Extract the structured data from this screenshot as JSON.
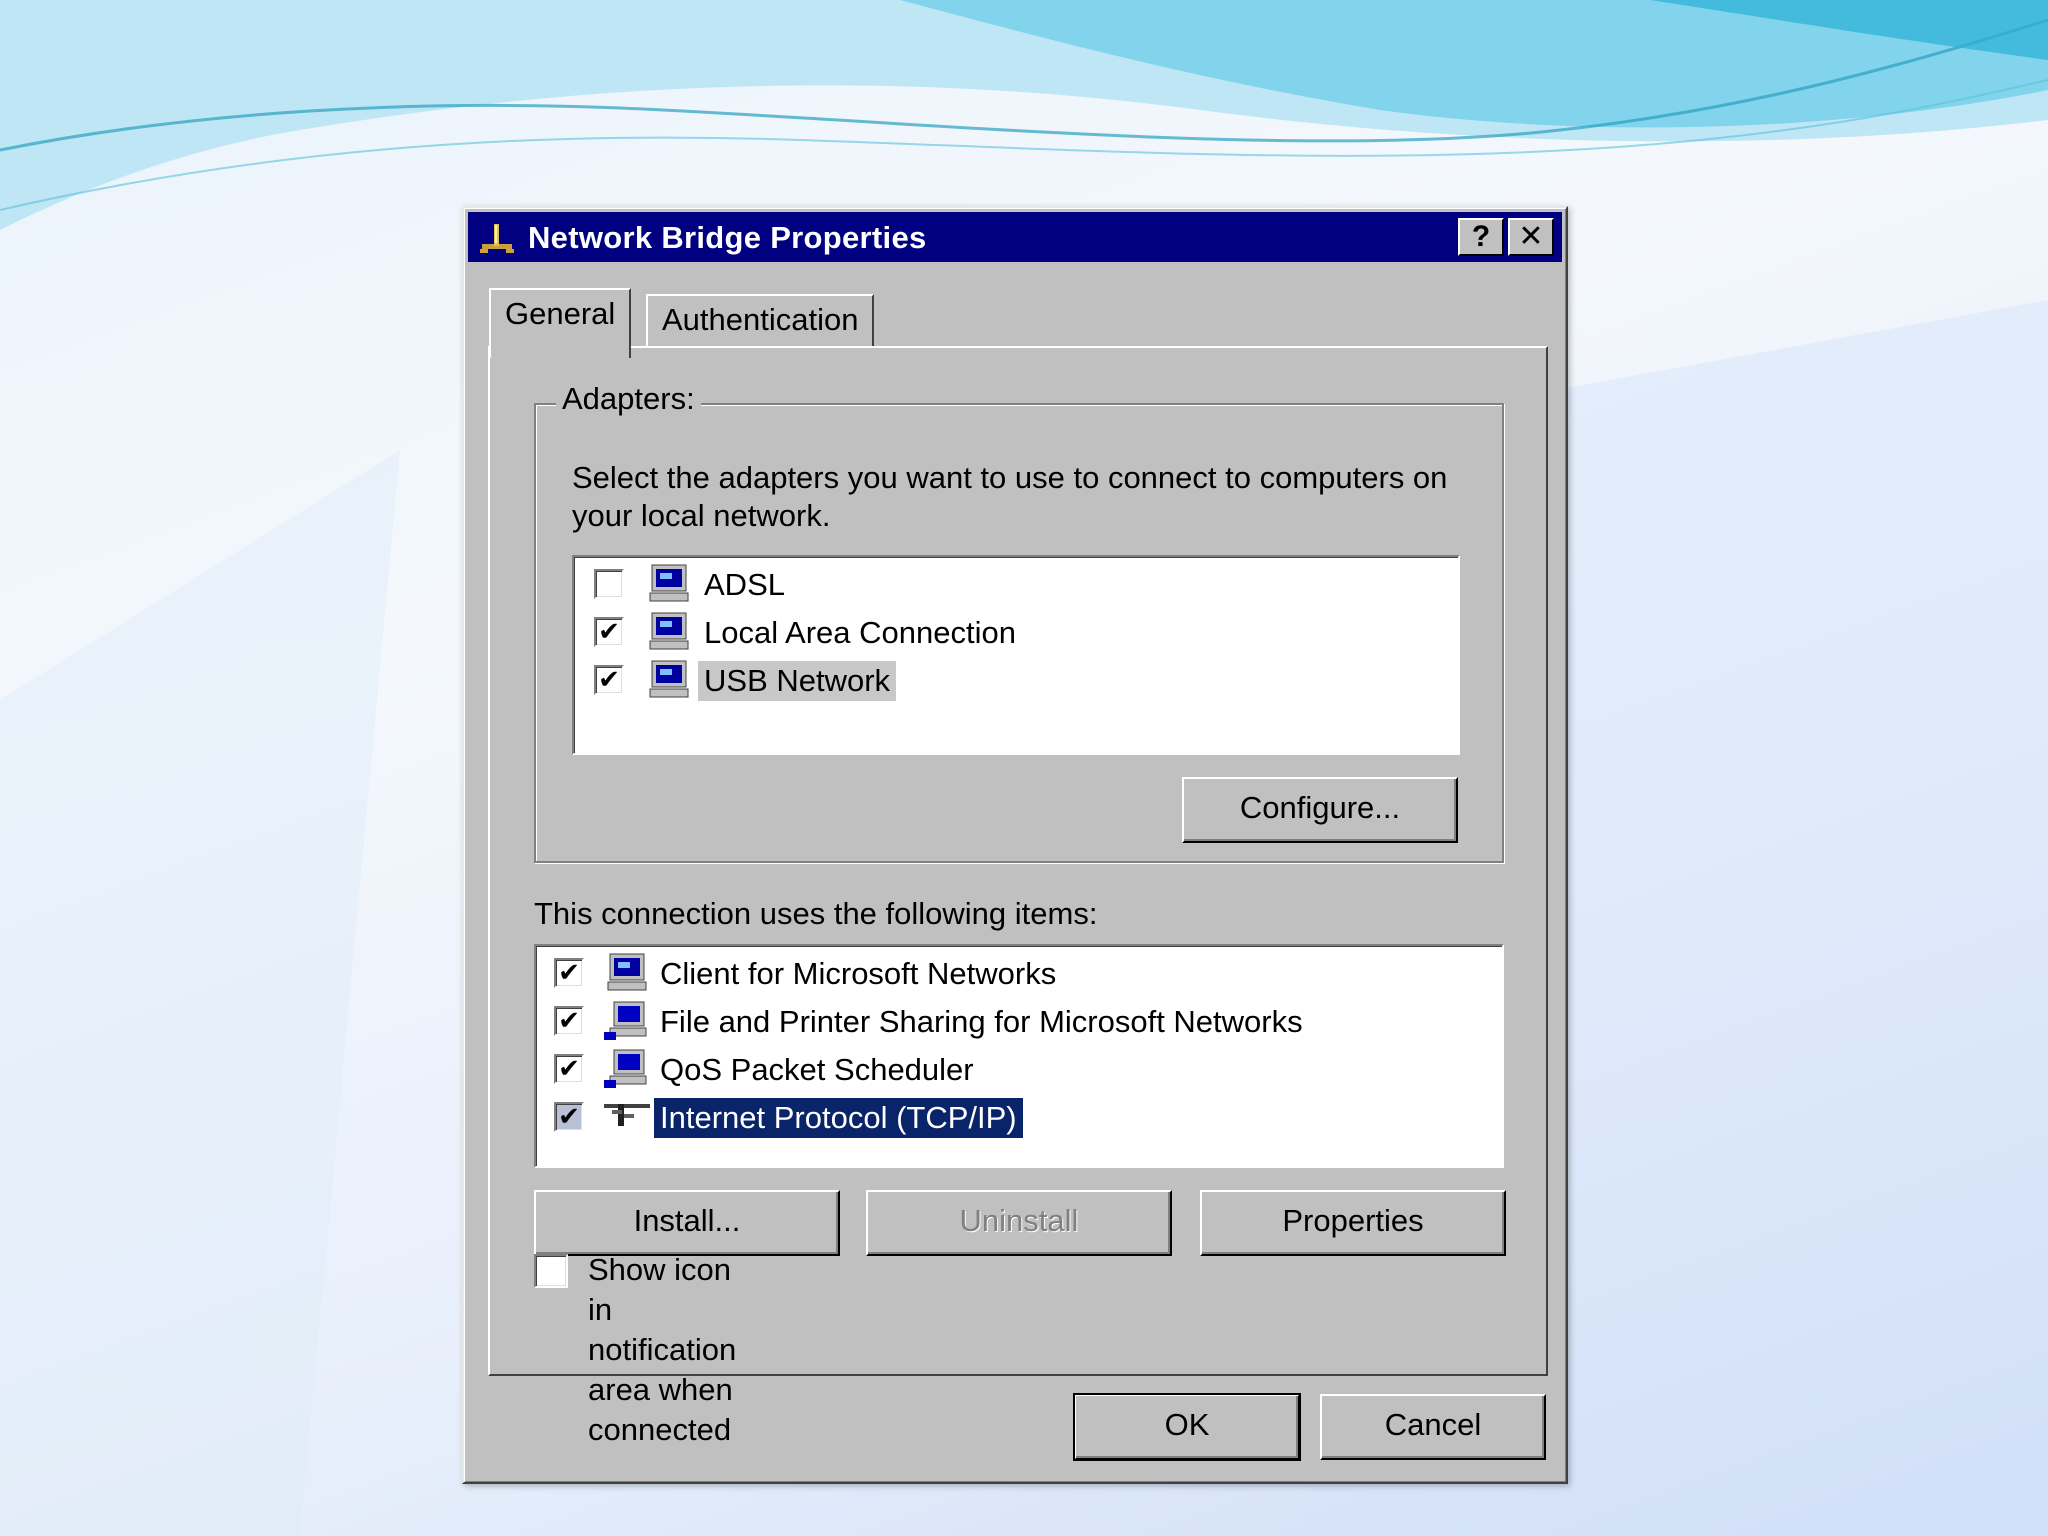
{
  "window": {
    "title": "Network Bridge Properties",
    "help_button": "?",
    "close_button": "✕"
  },
  "tabs": [
    {
      "label": "General",
      "active": true
    },
    {
      "label": "Authentication",
      "active": false
    }
  ],
  "adapters": {
    "legend": "Adapters:",
    "description": "Select the adapters you want to use to connect to computers on your local network.",
    "items": [
      {
        "label": "ADSL",
        "checked": false,
        "icon": "network-adapter-icon"
      },
      {
        "label": "Local Area Connection",
        "checked": true,
        "icon": "network-adapter-icon"
      },
      {
        "label": "USB Network",
        "checked": true,
        "icon": "network-adapter-icon",
        "selected": true
      }
    ],
    "configure_button": "Configure..."
  },
  "components": {
    "label": "This connection uses the following items:",
    "items": [
      {
        "label": "Client for Microsoft Networks",
        "checked": true,
        "icon": "network-client-icon"
      },
      {
        "label": "File and Printer Sharing for Microsoft Networks",
        "checked": true,
        "icon": "network-service-icon"
      },
      {
        "label": "QoS Packet Scheduler",
        "checked": true,
        "icon": "network-service-icon"
      },
      {
        "label": "Internet Protocol (TCP/IP)",
        "checked": true,
        "icon": "network-protocol-icon",
        "selected": true
      }
    ],
    "install_button": "Install...",
    "uninstall_button": "Uninstall",
    "properties_button": "Properties"
  },
  "notify": {
    "label": "Show icon in notification area when connected",
    "checked": false
  },
  "footer": {
    "ok_button": "OK",
    "cancel_button": "Cancel"
  },
  "colors": {
    "titlebar": "#000080",
    "face": "#c0c0c0",
    "selection": "#0a246a"
  }
}
